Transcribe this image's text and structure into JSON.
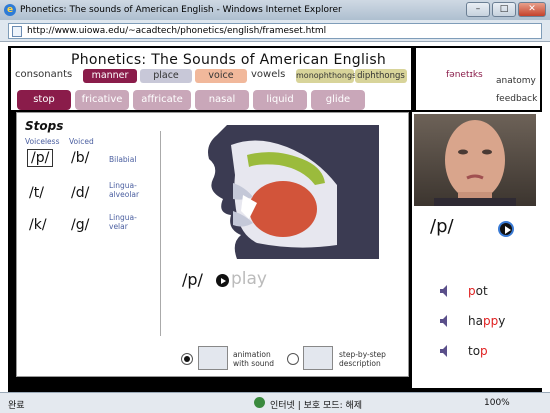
{
  "window": {
    "title": "Phonetics: The sounds of American English - Windows Internet Explorer"
  },
  "browser": {
    "url": "http://www.uiowa.edu/~acadtech/phonetics/english/frameset.html"
  },
  "site": {
    "title": "Phonetics:  The Sounds of American English"
  },
  "nav": {
    "consonants_label": "consonants",
    "vowels_label": "vowels",
    "manner": "manner",
    "place": "place",
    "voice": "voice",
    "monophthongs": "monophthongs",
    "diphthongs": "diphthongs"
  },
  "manner_tabs": [
    "stop",
    "fricative",
    "affricate",
    "nasal",
    "liquid",
    "glide"
  ],
  "sidebar_links": {
    "fonetiks": "fənetɪks",
    "anatomy": "anatomy",
    "feedback": "feedback"
  },
  "stops": {
    "title": "Stops",
    "voiceless_header": "Voiceless",
    "voiced_header": "Voiced",
    "rows": [
      {
        "voiceless": "/p/",
        "voiced": "/b/",
        "place": "Bilabial"
      },
      {
        "voiceless": "/t/",
        "voiced": "/d/",
        "place": "Lingua-\nalveolar"
      },
      {
        "voiceless": "/k/",
        "voiced": "/g/",
        "place": "Lingua-\nvelar"
      }
    ]
  },
  "player": {
    "symbol": "/p/",
    "play_label": "play"
  },
  "options": {
    "animation_label": "animation\nwith sound",
    "stepbystep_label": "step-by-step\ndescription",
    "selected": "animation"
  },
  "sidepanel": {
    "symbol": "/p/",
    "words": [
      {
        "pre": "",
        "hl": "p",
        "post": "ot"
      },
      {
        "pre": "ha",
        "hl": "pp",
        "post": "y"
      },
      {
        "pre": "to",
        "hl": "p",
        "post": ""
      }
    ]
  },
  "status": {
    "left": "완료",
    "zone": "인터넷 | 보호 모드: 해제",
    "zoom": "100%"
  },
  "colors": {
    "accent": "#8a1c4a",
    "manner_tab": "#8a1c4a",
    "place_tab": "#c8c8d8",
    "voice_tab": "#f1b89b",
    "vowel_tab": "#d8d49a"
  }
}
